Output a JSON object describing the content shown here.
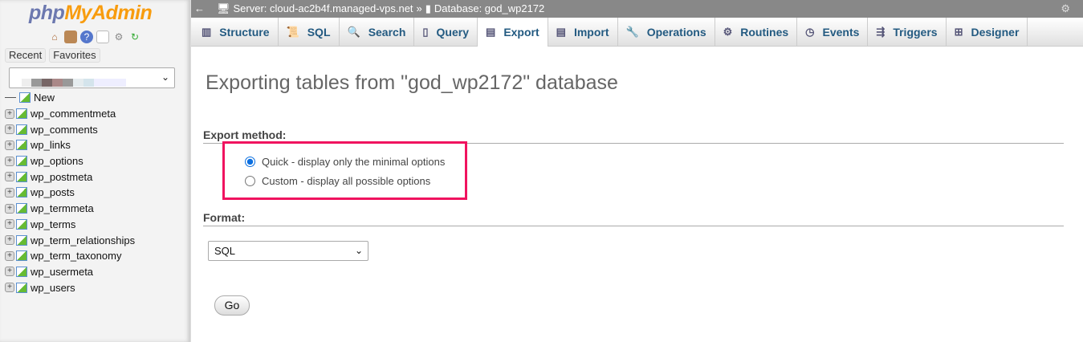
{
  "logo": {
    "part1": "php",
    "part2": "MyAdmin"
  },
  "sidebar": {
    "icons": [
      "home-icon",
      "logout-icon",
      "help-icon",
      "docs-icon",
      "settings-icon",
      "reload-icon"
    ],
    "recent": "Recent",
    "favorites": "Favorites",
    "new": "New",
    "tables": [
      "wp_commentmeta",
      "wp_comments",
      "wp_links",
      "wp_options",
      "wp_postmeta",
      "wp_posts",
      "wp_termmeta",
      "wp_terms",
      "wp_term_relationships",
      "wp_term_taxonomy",
      "wp_usermeta",
      "wp_users"
    ]
  },
  "topbar": {
    "server": "Server: cloud-ac2b4f.managed-vps.net",
    "sep": "»",
    "database": "Database: god_wp2172"
  },
  "tabs": [
    {
      "label": "Structure",
      "icon": "structure-icon"
    },
    {
      "label": "SQL",
      "icon": "sql-icon"
    },
    {
      "label": "Search",
      "icon": "search-icon"
    },
    {
      "label": "Query",
      "icon": "query-icon"
    },
    {
      "label": "Export",
      "icon": "export-icon",
      "active": true
    },
    {
      "label": "Import",
      "icon": "import-icon"
    },
    {
      "label": "Operations",
      "icon": "operations-icon"
    },
    {
      "label": "Routines",
      "icon": "routines-icon"
    },
    {
      "label": "Events",
      "icon": "events-icon"
    },
    {
      "label": "Triggers",
      "icon": "triggers-icon"
    },
    {
      "label": "Designer",
      "icon": "designer-icon"
    }
  ],
  "main": {
    "title": "Exporting tables from \"god_wp2172\" database",
    "export_method": "Export method:",
    "quick": "Quick - display only the minimal options",
    "custom": "Custom - display all possible options",
    "selected_method": "quick",
    "format_label": "Format:",
    "format_value": "SQL",
    "go": "Go"
  },
  "colors": {
    "highlight": "#f0135f",
    "tab_text": "#235a81",
    "topbar": "#888888"
  }
}
